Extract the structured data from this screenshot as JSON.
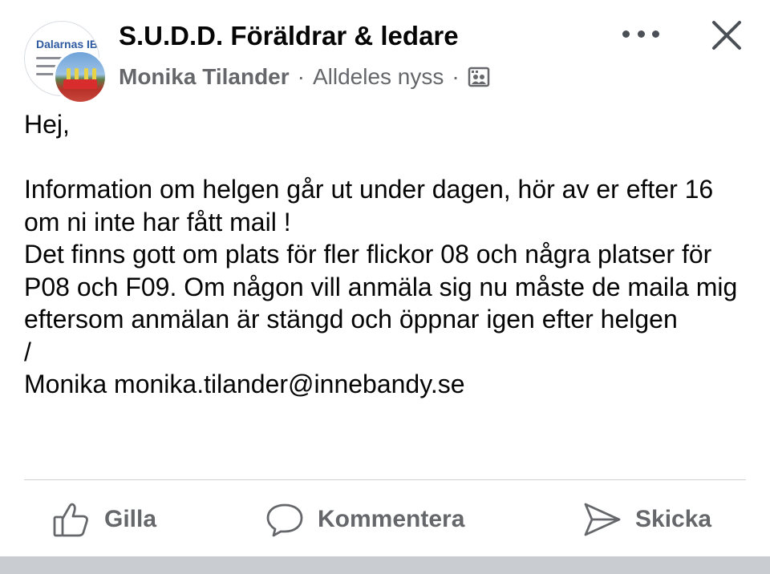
{
  "header": {
    "group_title": "S.U.D.D. Föräldrar & ledare",
    "group_avatar_text": "Dalarnas IB",
    "author": "Monika Tilander",
    "separator": "·",
    "timestamp": "Alldeles nyss",
    "privacy_icon": "group-members-icon",
    "more_icon": "more-options-icon",
    "close_icon": "close-icon"
  },
  "post": {
    "text": "Hej,\n\nInformation om helgen går ut under dagen, hör av er efter 16 om ni inte har fått mail !\nDet finns gott om plats för fler flickor 08 och några platser för P08 och F09. Om någon vill anmäla sig nu måste de maila mig eftersom anmälan är stängd och öppnar igen efter helgen\n/\nMonika monika.tilander@innebandy.se"
  },
  "actions": {
    "like_label": "Gilla",
    "comment_label": "Kommentera",
    "send_label": "Skicka"
  },
  "colors": {
    "text_primary": "#050505",
    "text_secondary": "#65676b",
    "divider": "#ced0d4"
  }
}
